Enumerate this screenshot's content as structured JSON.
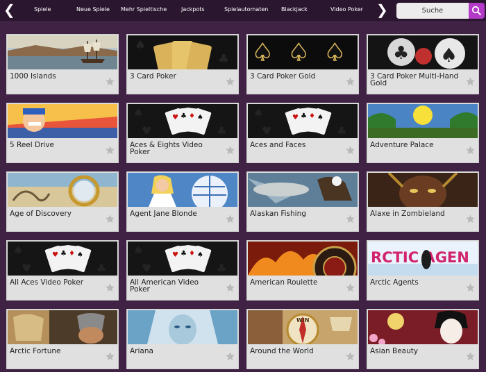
{
  "nav": {
    "prev_arrow": "❮",
    "next_arrow": "❯",
    "items": [
      "Spiele",
      "Neue Spiele",
      "Mehr Spieltische",
      "Jackpots",
      "Spielautomaten",
      "Blackjack",
      "Video Poker"
    ]
  },
  "search": {
    "label": "Suche",
    "button_color": "#b33ac7"
  },
  "games": [
    {
      "title": "1000 Islands",
      "art": "harbour"
    },
    {
      "title": "3 Card Poker",
      "art": "gold-cards"
    },
    {
      "title": "3 Card Poker Gold",
      "art": "gold-spades"
    },
    {
      "title": "3 Card Poker Multi-Hand Gold",
      "art": "silver-suits"
    },
    {
      "title": "5 Reel Drive",
      "art": "cartoon-driver"
    },
    {
      "title": "Aces & Eights Video Poker",
      "art": "aces-cards"
    },
    {
      "title": "Aces and Faces",
      "art": "aces-cards"
    },
    {
      "title": "Adventure Palace",
      "art": "jungle-sun"
    },
    {
      "title": "Age of Discovery",
      "art": "sea-map"
    },
    {
      "title": "Agent Jane Blonde",
      "art": "agent-globe"
    },
    {
      "title": "Alaskan Fishing",
      "art": "fish-eagle"
    },
    {
      "title": "Alaxe in Zombieland",
      "art": "dark-face"
    },
    {
      "title": "All Aces Video Poker",
      "art": "aces-cards"
    },
    {
      "title": "All American Video Poker",
      "art": "aces-cards"
    },
    {
      "title": "American Roulette",
      "art": "roulette-fire"
    },
    {
      "title": "Arctic Agents",
      "art": "arctic-logo"
    },
    {
      "title": "Arctic Fortune",
      "art": "viking"
    },
    {
      "title": "Ariana",
      "art": "ice-lady"
    },
    {
      "title": "Around the World",
      "art": "compass"
    },
    {
      "title": "Asian Beauty",
      "art": "geisha"
    }
  ],
  "arctic_logo_text": "RCTIC AGEN",
  "compass_text": "WIN"
}
